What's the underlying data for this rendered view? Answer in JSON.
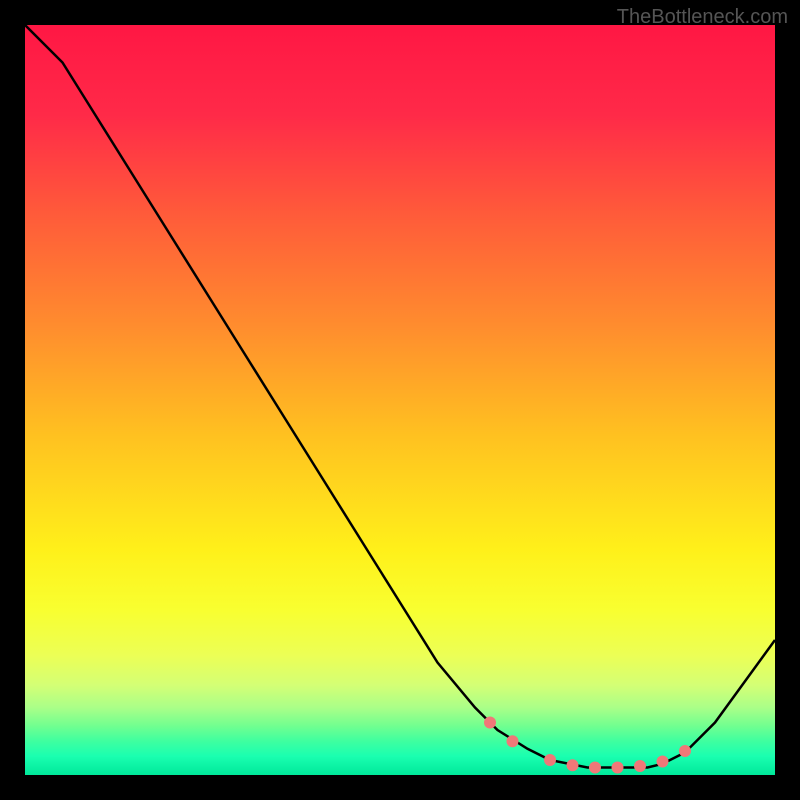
{
  "watermark": "TheBottleneck.com",
  "chart_data": {
    "type": "line",
    "title": "",
    "xlabel": "",
    "ylabel": "",
    "xlim": [
      0,
      100
    ],
    "ylim": [
      0,
      100
    ],
    "series": [
      {
        "name": "bottleneck-curve",
        "x": [
          0,
          5,
          10,
          15,
          20,
          25,
          30,
          35,
          40,
          45,
          50,
          55,
          60,
          63,
          67,
          70,
          75,
          80,
          83,
          85,
          88,
          92,
          100
        ],
        "y": [
          100,
          95,
          87,
          79,
          71,
          63,
          55,
          47,
          39,
          31,
          23,
          15,
          9,
          6,
          3.5,
          2,
          1,
          1,
          1,
          1.5,
          3,
          7,
          18
        ]
      }
    ],
    "markers": {
      "name": "highlight-points",
      "x": [
        62,
        65,
        70,
        73,
        76,
        79,
        82,
        85,
        88
      ],
      "y": [
        7,
        4.5,
        2,
        1.3,
        1,
        1,
        1.2,
        1.8,
        3.2
      ],
      "color": "#f07878"
    },
    "gradient_stops": [
      {
        "offset": 0,
        "color": "#ff1744"
      },
      {
        "offset": 12,
        "color": "#ff2a48"
      },
      {
        "offset": 25,
        "color": "#ff5a3a"
      },
      {
        "offset": 40,
        "color": "#ff8c2e"
      },
      {
        "offset": 55,
        "color": "#ffc220"
      },
      {
        "offset": 70,
        "color": "#fff01a"
      },
      {
        "offset": 78,
        "color": "#f8ff30"
      },
      {
        "offset": 84,
        "color": "#ecff55"
      },
      {
        "offset": 88,
        "color": "#d4ff75"
      },
      {
        "offset": 91,
        "color": "#aaff88"
      },
      {
        "offset": 93.5,
        "color": "#70ff90"
      },
      {
        "offset": 95.5,
        "color": "#3effa0"
      },
      {
        "offset": 97.5,
        "color": "#1affb0"
      },
      {
        "offset": 100,
        "color": "#00e89a"
      }
    ]
  }
}
